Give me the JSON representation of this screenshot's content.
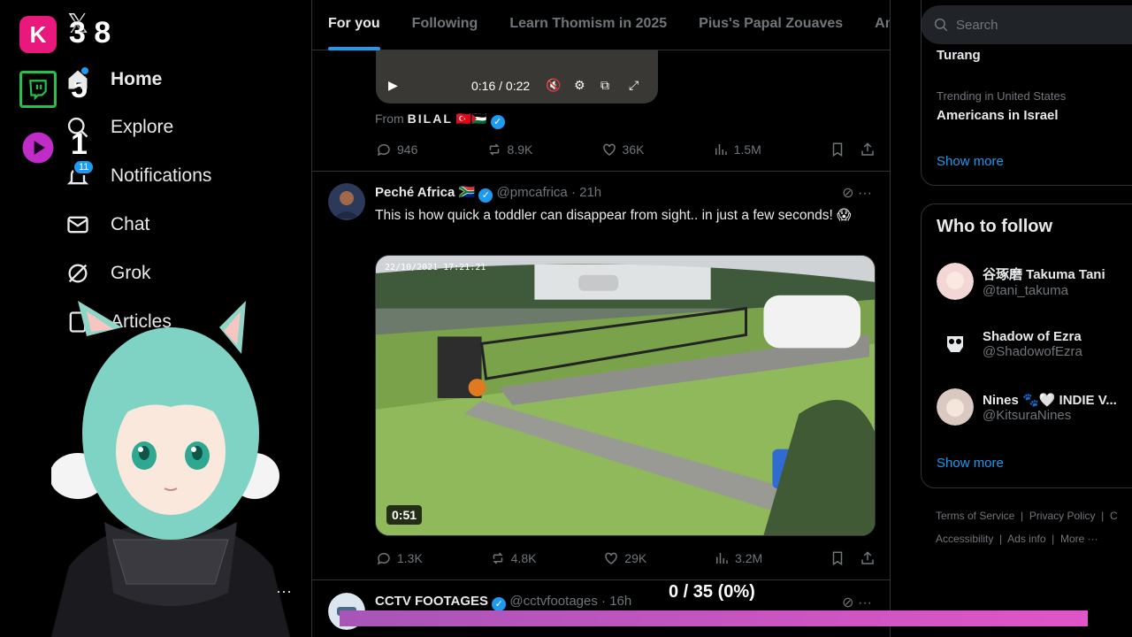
{
  "overlay": {
    "counters": [
      "3 8",
      "5",
      "1"
    ],
    "progress_label": "0 / 35 (0%)",
    "progress_fraction": 0
  },
  "nav": {
    "items": [
      {
        "label": "Home",
        "icon": "home-icon"
      },
      {
        "label": "Explore",
        "icon": "search-icon"
      },
      {
        "label": "Notifications",
        "icon": "bell-icon",
        "badge": "11"
      },
      {
        "label": "Chat",
        "icon": "mail-icon"
      },
      {
        "label": "Grok",
        "icon": "grok-icon"
      },
      {
        "label": "Articles",
        "icon": "article-icon"
      }
    ]
  },
  "tabs": [
    "For you",
    "Following",
    "Learn Thomism in 2025",
    "Pius's Papal Zouaves",
    "Am"
  ],
  "post1": {
    "video_time": "0:16 / 0:22",
    "from_label": "From",
    "from_name": "BILAL",
    "from_flags": "🇹🇷🇵🇸",
    "replies": "946",
    "reposts": "8.9K",
    "likes": "36K",
    "views": "1.5M"
  },
  "post2": {
    "name": "Peché Africa",
    "flag": "🇿🇦",
    "handle": "@pmcafrica",
    "time": "· 21h",
    "text": "This is how quick a toddler can disappear from sight.. in just a few seconds! 😱",
    "video_timestamp": "22/10/2021 17:21:21",
    "duration": "0:51",
    "replies": "1.3K",
    "reposts": "4.8K",
    "likes": "29K",
    "views": "3.2M"
  },
  "post3": {
    "name": "CCTV FOOTAGES",
    "handle": "@cctvfootages",
    "time": "· 16h"
  },
  "right": {
    "search_placeholder": "Search",
    "trend1": "Turang",
    "trend2_context": "Trending in United States",
    "trend2": "Americans in Israel",
    "show_more": "Show more",
    "who_to_follow": "Who to follow",
    "follow": [
      {
        "name": "谷琢磨 Takuma Tani",
        "handle": "@tani_takuma"
      },
      {
        "name": "Shadow of Ezra",
        "handle": "@ShadowofEzra"
      },
      {
        "name": "Nines 🐾🤍 INDIE V...",
        "handle": "@KitsuraNines"
      }
    ],
    "footer_line1": [
      "Terms of Service",
      "Privacy Policy",
      "C"
    ],
    "footer_line2": [
      "Accessibility",
      "Ads info",
      "More ···"
    ]
  },
  "colors": {
    "accent": "#1d9bf0",
    "kick": "#e8187d",
    "twitch": "#28c04c",
    "progress": "#d455c4"
  }
}
